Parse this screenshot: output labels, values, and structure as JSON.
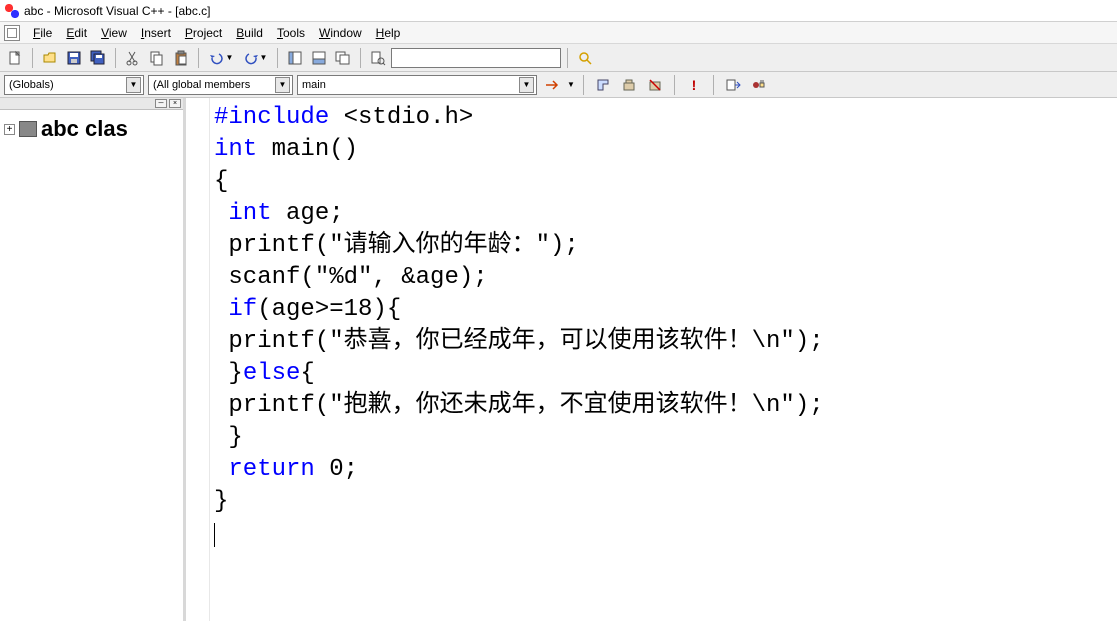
{
  "window": {
    "title": "abc - Microsoft Visual C++ - [abc.c]"
  },
  "menu": {
    "file": "File",
    "edit": "Edit",
    "view": "View",
    "insert": "Insert",
    "project": "Project",
    "build": "Build",
    "tools": "Tools",
    "window": "Window",
    "help": "Help"
  },
  "toolbar2": {
    "scope": "(Globals)",
    "members": "(All global members",
    "func": "main"
  },
  "classview": {
    "root": "abc clas"
  },
  "code": {
    "l1a": "#include",
    "l1b": " <stdio.h>",
    "l2a": "int",
    "l2b": " main()",
    "l3": "{",
    "l4a": " int",
    "l4b": " age;",
    "l5": " printf(\"请输入你的年龄：\");",
    "l6": " scanf(\"%d\", &age);",
    "l7a": " if",
    "l7b": "(age>=18){",
    "l8": " printf(\"恭喜，你已经成年，可以使用该软件！\\n\");",
    "l9a": " }",
    "l9b": "else",
    "l9c": "{",
    "l10": " printf(\"抱歉，你还未成年，不宜使用该软件！\\n\");",
    "l11": " }",
    "l12a": " return",
    "l12b": " 0;",
    "l13": "}"
  }
}
